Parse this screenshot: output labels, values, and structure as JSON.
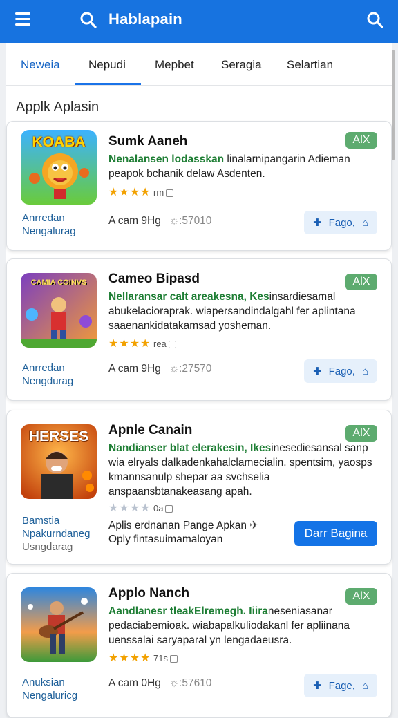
{
  "header": {
    "title": "Hablapain",
    "menu_icon": "menu-icon",
    "search_icon": "search-icon",
    "color": "#1773e0"
  },
  "tabs": [
    {
      "label": "Neweia",
      "active": true
    },
    {
      "label": "Nepudi",
      "active": false
    },
    {
      "label": "Mepbet",
      "active": false
    },
    {
      "label": "Seragia",
      "active": false
    },
    {
      "label": "Selartian",
      "active": false
    }
  ],
  "section_title": "Applk Aplasin",
  "apps": [
    {
      "name": "Sumk Aaneh",
      "badge": "AlX",
      "thumb_text": "KOABA",
      "desc_highlight": "Nenalansen lodasskan",
      "desc_rest": " linalarnipangarin Adieman peapok bchanik delaw Asdenten.",
      "rating": "rm",
      "stars": "★★★★",
      "side_line1": "Anrredan",
      "side_line2": "Nengalurag",
      "stats_size": "A cam 9Hg",
      "stats_downloads": "☼:57010",
      "action_label": "Fago,"
    },
    {
      "name": "Cameo Bipasd",
      "badge": "AlX",
      "thumb_text": "CAMIA COINVS",
      "desc_highlight": "Nellaransar calt areakesna, Kes",
      "desc_rest": "insardiesamal abukelacioraprak. wiapersandindalgahl fer aplintana saaenankidatakamsad yosheman.",
      "rating": "rea",
      "stars": "★★★★",
      "side_line1": "Anrredan",
      "side_line2": "Nengdurag",
      "stats_size": "A cam 9Hg",
      "stats_downloads": "☼:27570",
      "action_label": "Fago,"
    },
    {
      "name": "Apnle Canain",
      "badge": "AlX",
      "thumb_text": "HERSES",
      "desc_highlight": "Nandianser blat elerakesin, Ikes",
      "desc_rest": "inesediesansal sanp wia elryals dalkadenkahalclamecialin. spentsim, yaosps kmannsanulp shepar aa svchselia anspaansbtanakeasang apah.",
      "rating": "0a",
      "stars": "★★★★",
      "side_line1": "Bamstia",
      "side_line2": "Npakurndaneg",
      "side_line3": "Usngdarag",
      "promo_line1": "Aplis erdnanan Pange Apkan",
      "promo_line2": "Oply fintasuimamaloyan",
      "action_label": "Darr Bagina"
    },
    {
      "name": "Applo Nanch",
      "badge": "AlX",
      "thumb_text": "",
      "desc_highlight": "Aandlanesr tleakElremegh. Iiira",
      "desc_rest": "neseniasanar pedaciabemioak. wiabapalkuliodakanl fer apliinana uenssalai saryaparal yn lengadaeusra.",
      "rating": "71s",
      "stars": "★★★★",
      "side_line1": "Anuksian",
      "side_line2": "Nengaluricg",
      "stats_size": "A cam 0Hg",
      "stats_downloads": "☼:57610",
      "action_label": "Fage,"
    }
  ]
}
